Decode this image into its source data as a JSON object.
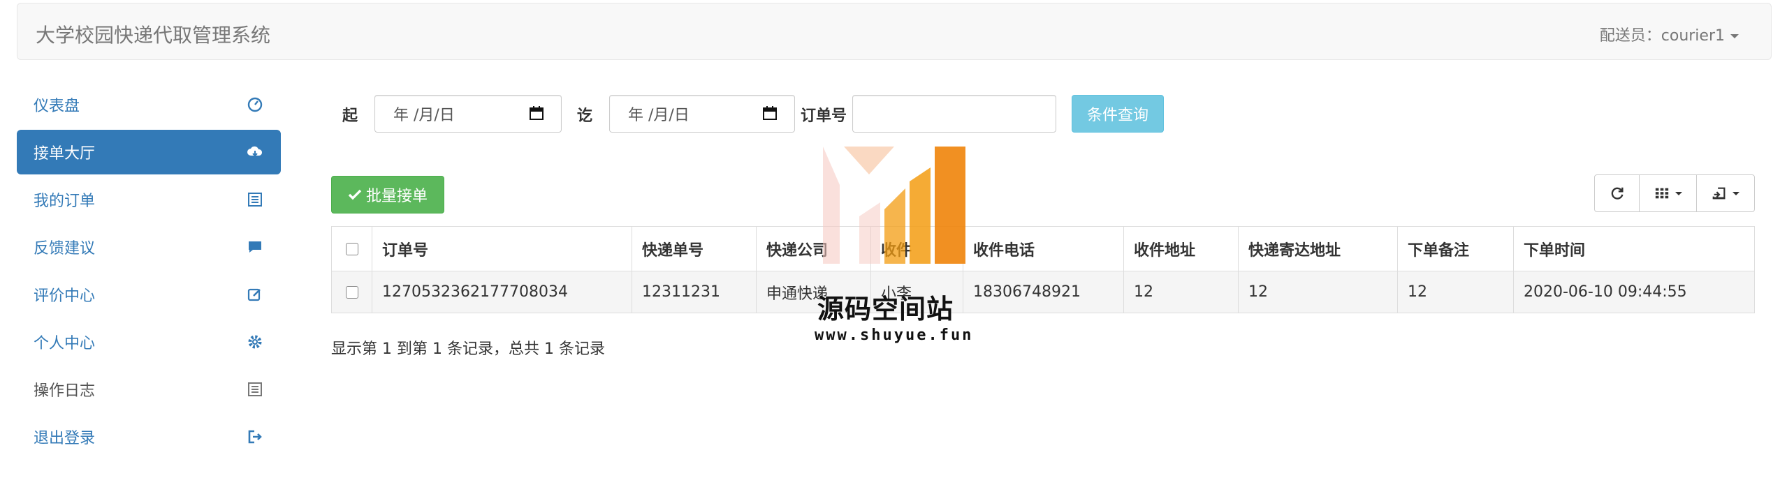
{
  "header": {
    "brand": "大学校园快递代取管理系统",
    "user_label": "配送员：courier1"
  },
  "sidebar": {
    "items": [
      {
        "label": "仪表盘",
        "icon": "dashboard-icon"
      },
      {
        "label": "接单大厅",
        "icon": "cloud-download-icon",
        "active": true
      },
      {
        "label": "我的订单",
        "icon": "list-alt-icon"
      },
      {
        "label": "反馈建议",
        "icon": "comment-icon"
      },
      {
        "label": "评价中心",
        "icon": "edit-icon"
      },
      {
        "label": "个人中心",
        "icon": "cog-icon"
      },
      {
        "label": "操作日志",
        "icon": "list-icon"
      },
      {
        "label": "退出登录",
        "icon": "log-out-icon"
      }
    ]
  },
  "query": {
    "start_label": "起",
    "start_value": "年 /月/日",
    "end_label": "讫",
    "end_value": "年 /月/日",
    "order_label": "订单号",
    "order_value": "",
    "search_label": "条件查询"
  },
  "toolbar": {
    "batch_label": "批量接单"
  },
  "table": {
    "columns": [
      "订单号",
      "快递单号",
      "快递公司",
      "收件",
      "收件电话",
      "收件地址",
      "快递寄达地址",
      "下单备注",
      "下单时间"
    ],
    "rows": [
      [
        "1270532362177708034",
        "12311231",
        "申通快递",
        "小李",
        "18306748921",
        "12",
        "12",
        "12",
        "2020-06-10 09:44:55"
      ]
    ]
  },
  "pagination": {
    "info": "显示第 1 到第 1 条记录，总共 1 条记录"
  },
  "watermark": {
    "title": "源码空间站",
    "url": "www.shuyue.fun"
  },
  "colors": {
    "primary": "#337ab7",
    "success": "#5cb85c",
    "info": "#5bc0de",
    "logo_orange": "#f39c12"
  }
}
